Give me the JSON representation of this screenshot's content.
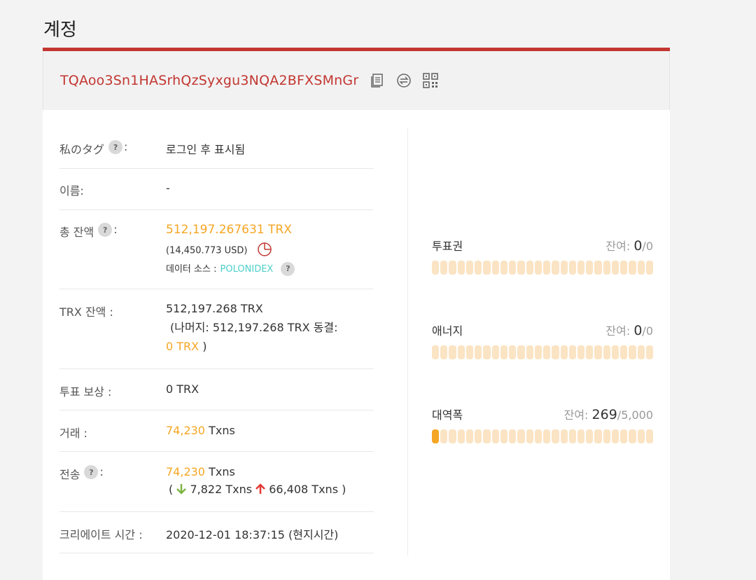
{
  "page": {
    "title": "계정"
  },
  "address": {
    "value": "TQAoo3Sn1HASrhQzSyxgu3NQA2BFXSMnGr"
  },
  "rows": {
    "tag": {
      "label": "私のタグ",
      "suffix": ":",
      "value": "로그인 후 표시됨"
    },
    "name": {
      "label": "이름:",
      "value": "-"
    },
    "total_balance": {
      "label": "총 잔액",
      "suffix": ":",
      "trx": "512,197.267631 TRX",
      "usd": "(14,450.773 USD)",
      "source_label": "데이터 소스 :",
      "source": "POLONIDEX"
    },
    "trx_balance": {
      "label": "TRX 잔액  :",
      "value": "512,197.268 TRX",
      "rest_line": "(나머지: 512,197.268 TRX  동결:",
      "frozen": "0 TRX",
      "close": ")"
    },
    "vote_reward": {
      "label": "투표 보상  :",
      "value": "0 TRX"
    },
    "transactions": {
      "label": "거래  :",
      "count": "74,230",
      "unit": "Txns"
    },
    "transfers": {
      "label": "전송",
      "suffix": ":",
      "count": "74,230",
      "unit": "Txns",
      "open": "(",
      "in": "7,822 Txns",
      "out": "66,408 Txns )"
    },
    "created": {
      "label": "크리에이트 시간  :",
      "value": "2020-12-01 18:37:15 (현지시간)"
    }
  },
  "resources": [
    {
      "name": "투표권",
      "remain_label": "잔여:",
      "remain": "0",
      "total": "/0",
      "fraction": 0
    },
    {
      "name": "애너지",
      "remain_label": "잔여:",
      "remain": "0",
      "total": "/0",
      "fraction": 0
    },
    {
      "name": "대역폭",
      "remain_label": "잔여:",
      "remain": "269",
      "total": "/5,000",
      "fraction": 0.0538
    }
  ],
  "colors": {
    "accent": "#c23631",
    "orange": "#f5a623",
    "teal": "#4dd0c8",
    "bar_empty": "#fbe4c4"
  }
}
